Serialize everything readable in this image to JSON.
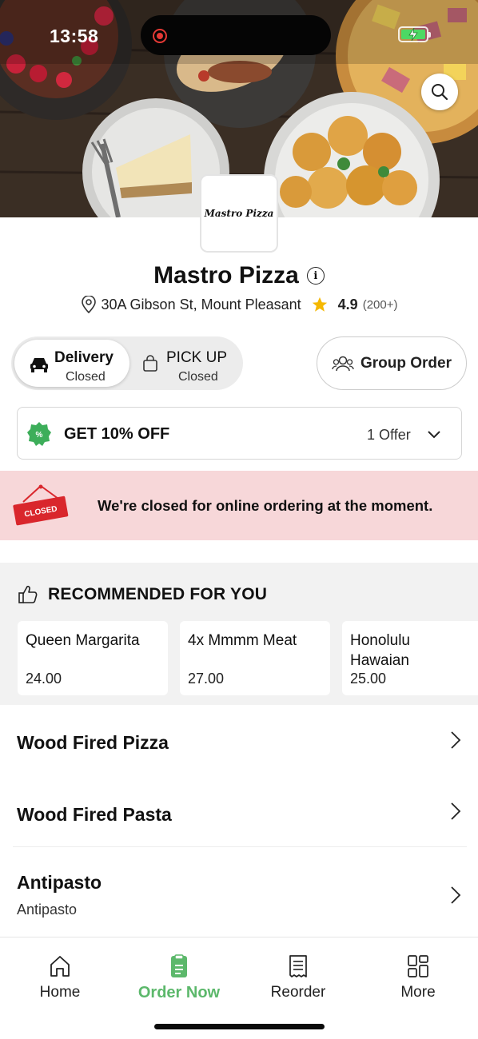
{
  "status_bar": {
    "time": "13:58"
  },
  "restaurant": {
    "logo_text": "Mastro Pizza",
    "name": "Mastro Pizza",
    "address": "30A Gibson St, Mount Pleasant",
    "rating": "4.9",
    "rating_count": "(200+)"
  },
  "order_modes": {
    "delivery": {
      "label": "Delivery",
      "status": "Closed"
    },
    "pickup": {
      "label": "PICK UP",
      "status": "Closed"
    },
    "group_order_label": "Group Order"
  },
  "offer": {
    "title": "GET 10% OFF",
    "count": "1 Offer"
  },
  "closed_banner": {
    "sign_text": "CLOSED",
    "message": "We're closed for online ordering at the moment."
  },
  "recommended": {
    "title": "RECOMMENDED FOR YOU",
    "items": [
      {
        "name": "Queen Margarita",
        "price": "24.00"
      },
      {
        "name": "4x Mmmm Meat",
        "price": "27.00"
      },
      {
        "name": "Honolulu Hawaian",
        "price": "25.00"
      }
    ]
  },
  "categories": [
    {
      "title": "Wood Fired Pizza",
      "subtitle": ""
    },
    {
      "title": "Wood Fired Pasta",
      "subtitle": ""
    },
    {
      "title": "Antipasto",
      "subtitle": "Antipasto"
    }
  ],
  "tabbar": {
    "items": [
      {
        "label": "Home",
        "icon": "home-icon"
      },
      {
        "label": "Order Now",
        "icon": "order-icon"
      },
      {
        "label": "Reorder",
        "icon": "receipt-icon"
      },
      {
        "label": "More",
        "icon": "grid-icon"
      }
    ]
  },
  "colors": {
    "accent_green": "#5cb86b",
    "closed_banner_bg": "#f7d7d9",
    "closed_sign_red": "#d9262c",
    "star_gold": "#f5b800"
  }
}
